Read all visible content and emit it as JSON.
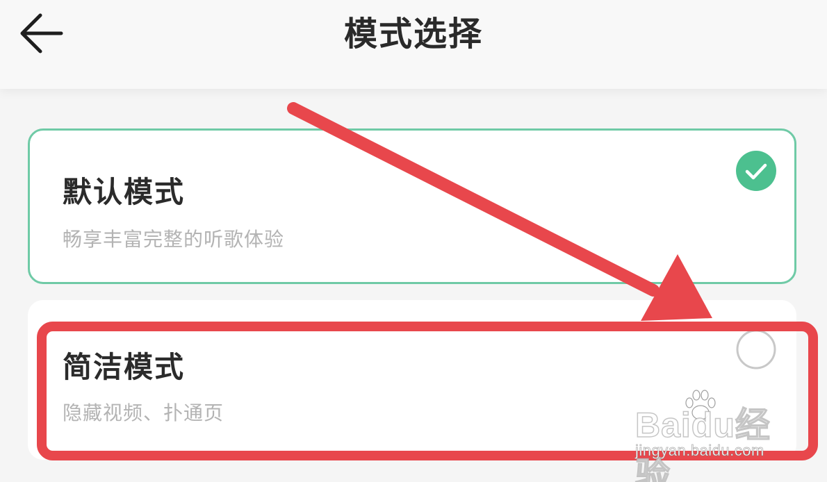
{
  "header": {
    "title": "模式选择",
    "back_icon": "arrow-left-icon"
  },
  "modes": [
    {
      "title": "默认模式",
      "description": "畅享丰富完整的听歌体验",
      "selected": true,
      "radio_icon": "check-circle-icon"
    },
    {
      "title": "简洁模式",
      "description": "隐藏视频、扑通页",
      "selected": false,
      "radio_icon": "empty-circle-icon"
    }
  ],
  "watermark": {
    "brand": "Baidu经验",
    "url": "jingyan.baidu.com"
  },
  "colors": {
    "accent_green": "#4cc08f",
    "selected_border": "#6fcaa6",
    "annotation_red": "#e8474c",
    "title_text": "#2b2b2b",
    "desc_text": "#b3b3b3"
  }
}
